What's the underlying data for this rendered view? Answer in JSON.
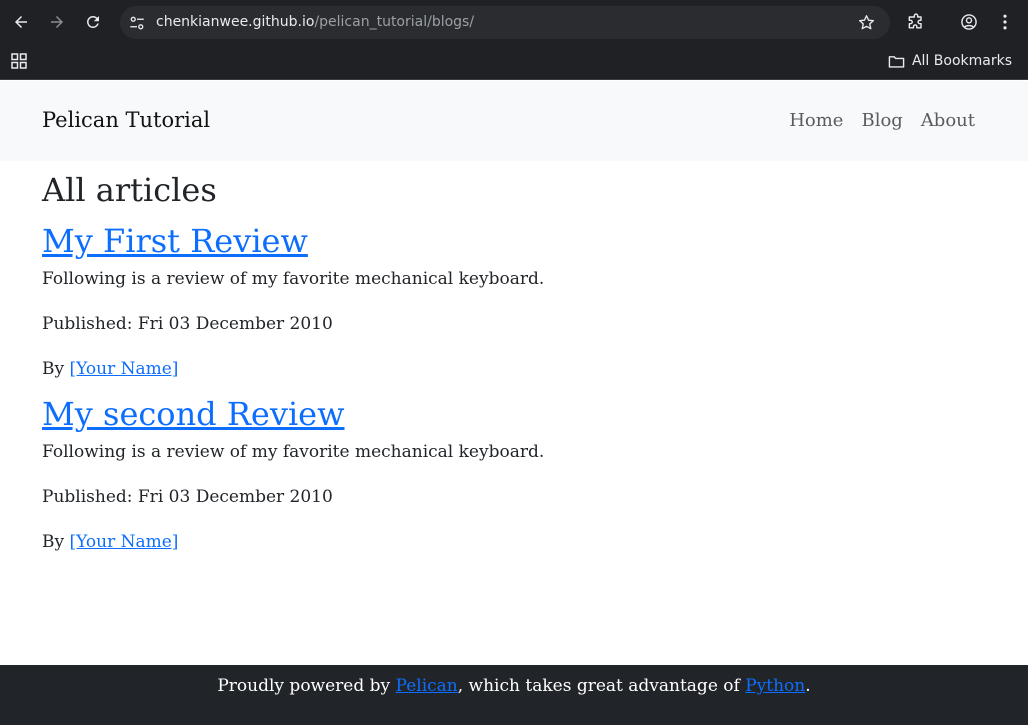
{
  "browser": {
    "url_host": "chenkianwee.github.io",
    "url_path": "/pelican_tutorial/blogs/",
    "bookmarks_label": "All Bookmarks",
    "icons": {
      "back": "arrow-left-icon",
      "forward": "arrow-right-icon",
      "reload": "reload-icon",
      "site_info": "tune-icon",
      "bookmark": "star-icon",
      "extensions": "puzzle-icon",
      "profile": "account-icon",
      "menu": "kebab-menu-icon",
      "apps": "apps-grid-icon",
      "folder": "folder-icon"
    },
    "colors": {
      "chrome_bg": "#202124",
      "omnibox_bg": "#2b2c2f",
      "url_host": "#e8eaed",
      "url_path": "#9aa0a6"
    }
  },
  "site": {
    "brand": "Pelican Tutorial",
    "nav": [
      {
        "label": "Home"
      },
      {
        "label": "Blog"
      },
      {
        "label": "About"
      }
    ],
    "colors": {
      "header_bg": "#f8f9fa",
      "link": "#0d6efd",
      "footer_bg": "#212529"
    }
  },
  "main": {
    "heading": "All articles",
    "articles": [
      {
        "title": "My First Review",
        "summary": "Following is a review of my favorite mechanical keyboard.",
        "published": "Published: Fri 03 December 2010",
        "by_label": "By",
        "author": "[Your Name]"
      },
      {
        "title": "My second Review",
        "summary": "Following is a review of my favorite mechanical keyboard.",
        "published": "Published: Fri 03 December 2010",
        "by_label": "By",
        "author": "[Your Name]"
      }
    ]
  },
  "footer": {
    "prefix": "Proudly powered by",
    "pelican_link": "Pelican",
    "middle": ", which takes great advantage of",
    "python_link": "Python",
    "suffix": "."
  }
}
